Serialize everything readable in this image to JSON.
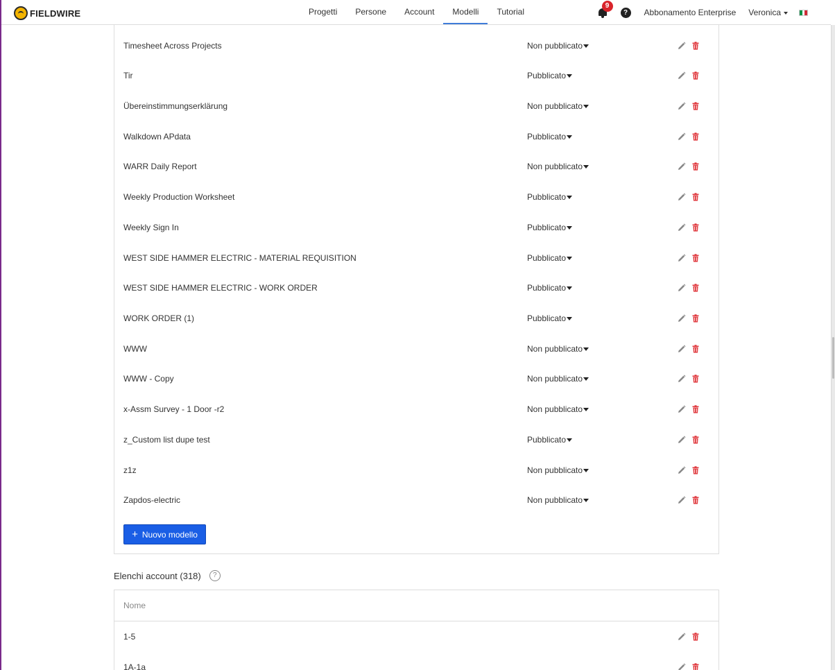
{
  "brand": {
    "name": "FIELDWIRE"
  },
  "nav": {
    "items": [
      {
        "label": "Progetti",
        "active": false
      },
      {
        "label": "Persone",
        "active": false
      },
      {
        "label": "Account",
        "active": false
      },
      {
        "label": "Modelli",
        "active": true
      },
      {
        "label": "Tutorial",
        "active": false
      }
    ]
  },
  "header_right": {
    "notification_count": "9",
    "help_label": "?",
    "plan": "Abbonamento Enterprise",
    "user": "Veronica",
    "flag_colors": [
      "#009246",
      "#ffffff",
      "#ce2b37"
    ]
  },
  "templates": {
    "rows": [
      {
        "name": "Timesheet Across Projects",
        "status": "Non pubblicato"
      },
      {
        "name": "Tir",
        "status": "Pubblicato"
      },
      {
        "name": "Übereinstimmungserklärung",
        "status": "Non pubblicato"
      },
      {
        "name": "Walkdown APdata",
        "status": "Pubblicato"
      },
      {
        "name": "WARR Daily Report",
        "status": "Non pubblicato"
      },
      {
        "name": "Weekly Production Worksheet",
        "status": "Pubblicato"
      },
      {
        "name": "Weekly Sign In",
        "status": "Pubblicato"
      },
      {
        "name": "WEST SIDE HAMMER ELECTRIC - MATERIAL REQUISITION",
        "status": "Pubblicato"
      },
      {
        "name": "WEST SIDE HAMMER ELECTRIC - WORK ORDER",
        "status": "Pubblicato"
      },
      {
        "name": "WORK ORDER (1)",
        "status": "Pubblicato"
      },
      {
        "name": "WWW",
        "status": "Non pubblicato"
      },
      {
        "name": "WWW - Copy",
        "status": "Non pubblicato"
      },
      {
        "name": "x-Assm Survey - 1 Door -r2",
        "status": "Non pubblicato"
      },
      {
        "name": "z_Custom list dupe test",
        "status": "Pubblicato"
      },
      {
        "name": "z1z",
        "status": "Non pubblicato"
      },
      {
        "name": "Zapdos-electric",
        "status": "Non pubblicato"
      }
    ],
    "new_button": "Nuovo modello",
    "new_button_icon": "+"
  },
  "account_lists": {
    "title": "Elenchi account (318)",
    "help_label": "?",
    "column_header": "Nome",
    "rows": [
      {
        "name": "1-5"
      },
      {
        "name": "1A-1a"
      }
    ]
  },
  "colors": {
    "accent": "#3f7cd9",
    "primary_button": "#1a5ee5",
    "delete_red": "#e0393e",
    "edit_gray": "#888888"
  }
}
